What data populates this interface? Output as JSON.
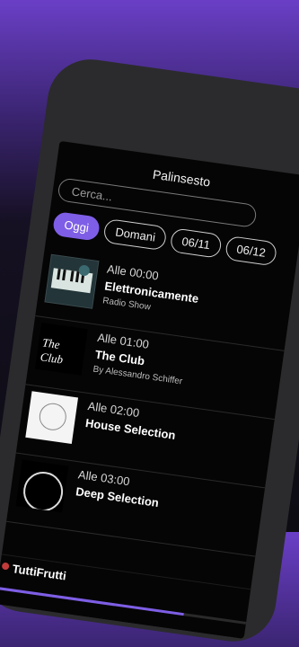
{
  "header": {
    "title": "Palinsesto"
  },
  "search": {
    "placeholder": "Cerca..."
  },
  "chips": [
    {
      "label": "Oggi",
      "active": true
    },
    {
      "label": "Domani",
      "active": false
    },
    {
      "label": "06/11",
      "active": false
    },
    {
      "label": "06/12",
      "active": false
    }
  ],
  "schedule": [
    {
      "time": "Alle 00:00",
      "title": "Elettronicamente",
      "subtitle": "Radio Show",
      "thumb": "piano-keyboard-image"
    },
    {
      "time": "Alle 01:00",
      "title": "The Club",
      "subtitle": "By Alessandro Schiffer",
      "thumb": "the-club-logo"
    },
    {
      "time": "Alle 02:00",
      "title": "House Selection",
      "subtitle": "",
      "thumb": "house-selection-logo"
    },
    {
      "time": "Alle 03:00",
      "title": "Deep Selection",
      "subtitle": "",
      "thumb": "deep-selection-logo"
    }
  ],
  "player": {
    "station": "TuttiFrutti",
    "progress": 0.75
  },
  "colors": {
    "accent": "#7e5ee6",
    "background": "#050505",
    "frame": "#2b2b2d"
  }
}
